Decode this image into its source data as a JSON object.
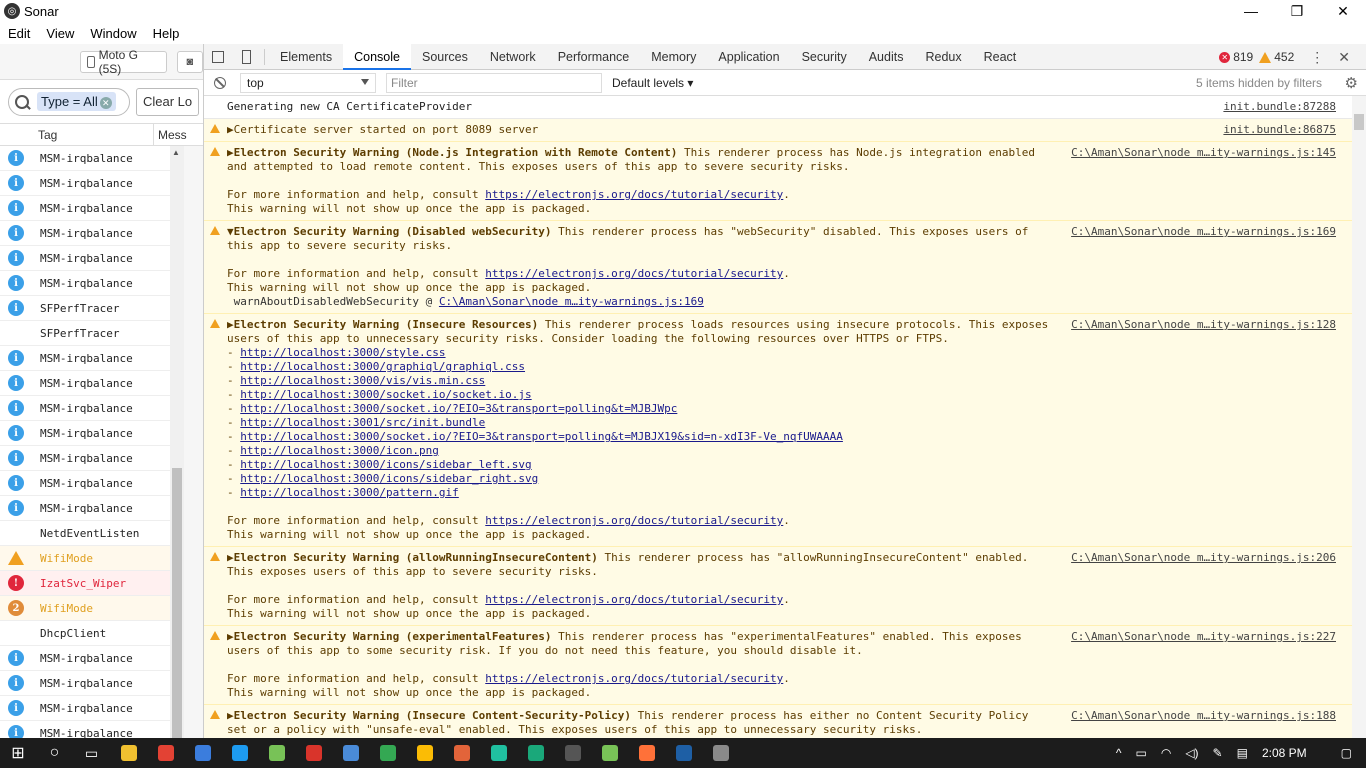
{
  "window": {
    "title": "Sonar",
    "controls": [
      "—",
      "❐",
      "✕"
    ]
  },
  "menu": [
    "Edit",
    "View",
    "Window",
    "Help"
  ],
  "left_panel": {
    "device": "Moto G (5S)",
    "search_token": "Type = All",
    "clear_label": "Clear Lo",
    "columns": {
      "tag": "Tag",
      "message": "Mess"
    },
    "rows": [
      {
        "tag": "MSM-irqbalance",
        "level": "info"
      },
      {
        "tag": "MSM-irqbalance",
        "level": "info"
      },
      {
        "tag": "MSM-irqbalance",
        "level": "info"
      },
      {
        "tag": "MSM-irqbalance",
        "level": "info"
      },
      {
        "tag": "MSM-irqbalance",
        "level": "info"
      },
      {
        "tag": "MSM-irqbalance",
        "level": "info"
      },
      {
        "tag": "SFPerfTracer",
        "level": "info"
      },
      {
        "tag": "SFPerfTracer",
        "level": "none"
      },
      {
        "tag": "MSM-irqbalance",
        "level": "info"
      },
      {
        "tag": "MSM-irqbalance",
        "level": "info"
      },
      {
        "tag": "MSM-irqbalance",
        "level": "info"
      },
      {
        "tag": "MSM-irqbalance",
        "level": "info"
      },
      {
        "tag": "MSM-irqbalance",
        "level": "info"
      },
      {
        "tag": "MSM-irqbalance",
        "level": "info"
      },
      {
        "tag": "MSM-irqbalance",
        "level": "info"
      },
      {
        "tag": "NetdEventListen",
        "level": "none"
      },
      {
        "tag": "WifiMode",
        "level": "warn"
      },
      {
        "tag": "IzatSvc_Wiper",
        "level": "err"
      },
      {
        "tag": "WifiMode",
        "level": "cnt",
        "count": "2"
      },
      {
        "tag": "DhcpClient",
        "level": "none"
      },
      {
        "tag": "MSM-irqbalance",
        "level": "info"
      },
      {
        "tag": "MSM-irqbalance",
        "level": "info"
      },
      {
        "tag": "MSM-irqbalance",
        "level": "info"
      },
      {
        "tag": "MSM-irqbalance",
        "level": "info"
      }
    ]
  },
  "devtools": {
    "tabs": [
      "Elements",
      "Console",
      "Sources",
      "Network",
      "Performance",
      "Memory",
      "Application",
      "Security",
      "Audits",
      "Redux",
      "React"
    ],
    "active_tab": "Console",
    "error_count": "819",
    "warning_count": "452",
    "context": "top",
    "filter_placeholder": "Filter",
    "levels": "Default levels",
    "hidden_note": "5 items hidden by filters"
  },
  "console": {
    "m1_text": "Generating new CA CertificateProvider",
    "m1_src": "init.bundle:87288",
    "m2_text": "Certificate server started on port 8089 server",
    "m2_src": "init.bundle:86875",
    "m3_title": "Electron Security Warning (Node.js Integration with Remote Content)",
    "m3_rest": " This renderer process has Node.js integration enabled",
    "m3_l2": "and attempted to load remote content. This exposes users of this app to severe security risks.",
    "m3_src": "C:\\Aman\\Sonar\\node m…ity-warnings.js:145",
    "help_prefix": "For more information and help, consult ",
    "help_link": "https://electronjs.org/docs/tutorial/security",
    "help_suffix": ".",
    "packaged": "This warning will not show up once the app is packaged.",
    "m4_title": "Electron Security Warning (Disabled webSecurity)",
    "m4_rest": " This renderer process has \"webSecurity\" disabled. This exposes users of",
    "m4_l2": "this app to severe security risks.",
    "m4_src": "C:\\Aman\\Sonar\\node m…ity-warnings.js:169",
    "m4_stack_fn": "warnAboutDisabledWebSecurity @ ",
    "m4_stack_link": "C:\\Aman\\Sonar\\node m…ity-warnings.js:169",
    "m5_title": "Electron Security Warning (Insecure Resources)",
    "m5_rest": " This renderer process loads resources using insecure protocols. This exposes",
    "m5_l2": "users of this app to unnecessary security risks. Consider loading the following resources over HTTPS or FTPS.",
    "m5_src": "C:\\Aman\\Sonar\\node m…ity-warnings.js:128",
    "m5_urls": [
      "http://localhost:3000/style.css",
      "http://localhost:3000/graphiql/graphiql.css",
      "http://localhost:3000/vis/vis.min.css",
      "http://localhost:3000/socket.io/socket.io.js",
      "http://localhost:3000/socket.io/?EIO=3&transport=polling&t=MJBJWpc",
      "http://localhost:3001/src/init.bundle",
      "http://localhost:3000/socket.io/?EIO=3&transport=polling&t=MJBJX19&sid=n-xdI3F-Ve_nqfUWAAAA",
      "http://localhost:3000/icon.png",
      "http://localhost:3000/icons/sidebar_left.svg",
      "http://localhost:3000/icons/sidebar_right.svg",
      "http://localhost:3000/pattern.gif"
    ],
    "m6_title": "Electron Security Warning (allowRunningInsecureContent)",
    "m6_rest": " This renderer process has \"allowRunningInsecureContent\" enabled.",
    "m6_l2": "This exposes users of this app to severe security risks.",
    "m6_src": "C:\\Aman\\Sonar\\node m…ity-warnings.js:206",
    "m7_title": "Electron Security Warning (experimentalFeatures)",
    "m7_rest": " This renderer process has \"experimentalFeatures\" enabled. This exposes",
    "m7_l2": "users of this app to some security risk. If you do not need this feature, you should disable it.",
    "m7_src": "C:\\Aman\\Sonar\\node m…ity-warnings.js:227",
    "m8_title": "Electron Security Warning (Insecure Content-Security-Policy)",
    "m8_rest": " This renderer process has either no Content Security Policy",
    "m8_l2": "set or a policy with \"unsafe-eval\" enabled. This exposes users of this app to unnecessary security risks.",
    "m8_src": "C:\\Aman\\Sonar\\node m…ity-warnings.js:188"
  },
  "taskbar": {
    "time": "2:08 PM",
    "app_colors": [
      "#f0c030",
      "#e34234",
      "#3b7ddd",
      "#1d9bf0",
      "#78c257",
      "#d9342b",
      "#4a8bd8",
      "#34a853",
      "#fbbc05",
      "#e2643a",
      "#20c0a0",
      "#1aa87a",
      "#555555",
      "#78c257",
      "#ff7139",
      "#1e5fa5",
      "#8a8a8a"
    ]
  }
}
